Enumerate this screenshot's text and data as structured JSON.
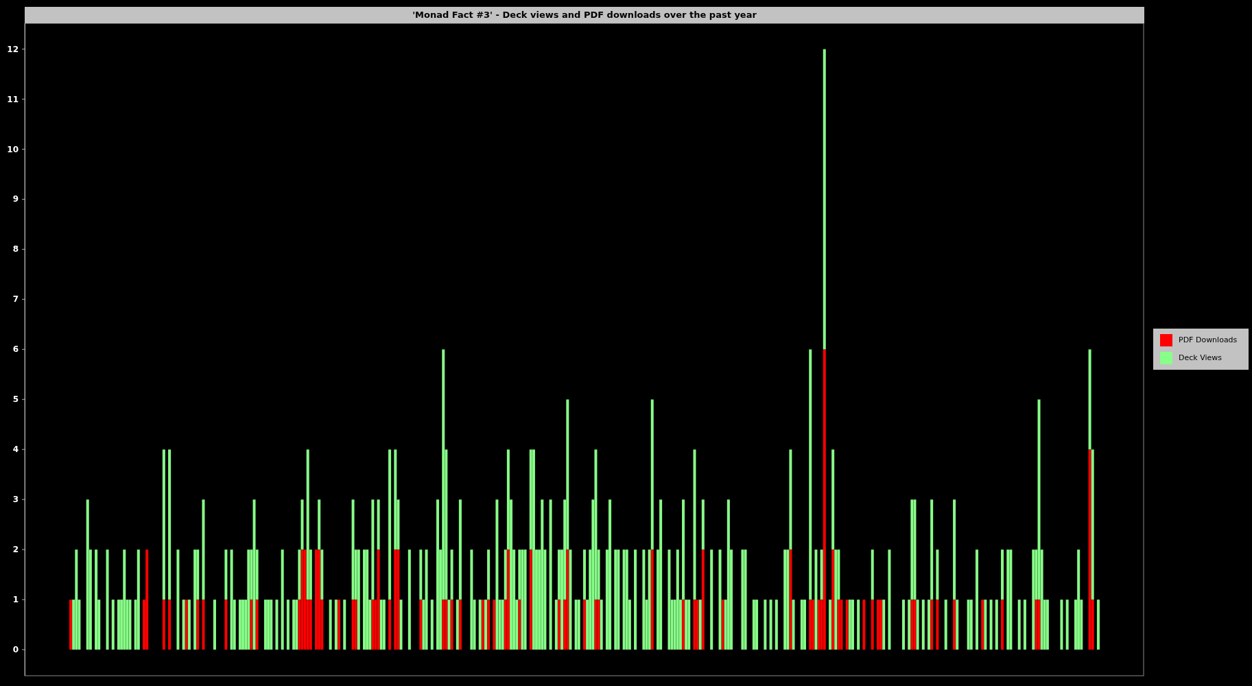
{
  "chart": {
    "title": "'Monad Fact #3' - Deck views and PDF downloads over the past year",
    "y_axis": {
      "ticks": [
        "12",
        "11",
        "10",
        "9",
        "8",
        "7",
        "6",
        "5",
        "4",
        "3",
        "2",
        "1",
        "0"
      ]
    },
    "legend": [
      {
        "label": "PDF Downloads",
        "color": "#ff0000"
      },
      {
        "label": "Deck Views",
        "color": "#88ff88"
      }
    ]
  }
}
